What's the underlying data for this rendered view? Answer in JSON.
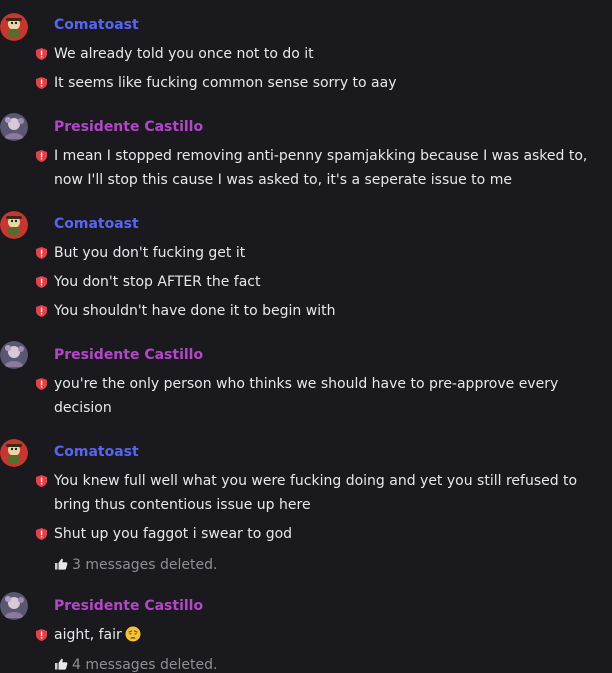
{
  "colors": {
    "background": "#1a1a1e",
    "author_comatoast": "#5865f2",
    "author_presidente": "#b346c9",
    "flag": "#e0444a",
    "deleted_text": "#8e8e95"
  },
  "groups": [
    {
      "author": "Comatoast",
      "messages": [
        "We already told you once not to do it",
        "It seems like fucking common sense sorry to aay"
      ]
    },
    {
      "author": "Presidente Castillo",
      "messages": [
        "I mean I stopped removing anti-penny spamjakking because I was asked to, now I'll stop this cause I was asked to, it's a seperate issue to me"
      ]
    },
    {
      "author": "Comatoast",
      "messages": [
        "But you don't fucking get it",
        "You don't stop AFTER the fact",
        "You shouldn't have done it to begin with"
      ]
    },
    {
      "author": "Presidente Castillo",
      "messages": [
        "you're the only person who thinks we should have to pre-approve every decision"
      ]
    },
    {
      "author": "Comatoast",
      "messages": [
        "You knew full well what you were fucking doing and yet you still refused to bring thus contentious issue up here",
        "Shut up you faggot i swear to god"
      ],
      "deleted_note": "3 messages deleted."
    },
    {
      "author": "Presidente Castillo",
      "messages": [
        "aight, fair"
      ],
      "emoji": "weary-face-emoji",
      "deleted_note": "4 messages deleted."
    }
  ]
}
